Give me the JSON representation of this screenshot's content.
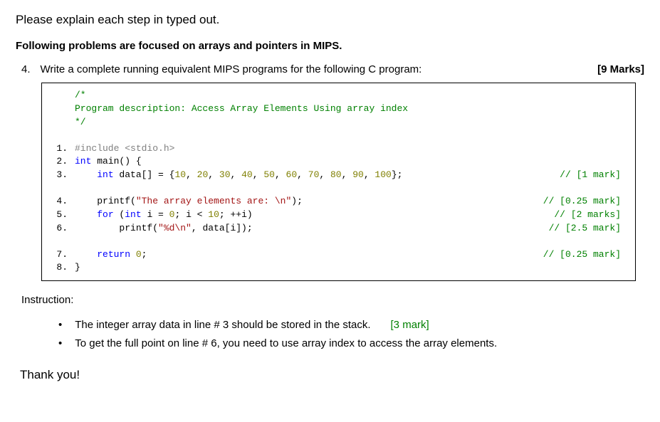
{
  "intro": "Please explain each step in typed out.",
  "heading": "Following problems are focused on arrays and pointers in MIPS.",
  "question": {
    "number": "4.",
    "text": "Write a complete running equivalent MIPS programs for the following C program:",
    "marks": "[9 Marks]"
  },
  "code": {
    "comment_open": "/*",
    "comment_body": "Program description: Access Array Elements Using array index",
    "comment_close": "*/",
    "lines": [
      {
        "n": "1.",
        "indent": "",
        "tokens": [
          {
            "t": "#include ",
            "c": "pp"
          },
          {
            "t": "<stdio.h>",
            "c": "inc-str"
          }
        ],
        "mark": ""
      },
      {
        "n": "2.",
        "indent": "",
        "tokens": [
          {
            "t": "int",
            "c": "type"
          },
          {
            "t": " main() {",
            "c": ""
          }
        ],
        "mark": ""
      },
      {
        "n": "3.",
        "indent": "    ",
        "tokens": [
          {
            "t": "int",
            "c": "type"
          },
          {
            "t": " data[] = {",
            "c": ""
          },
          {
            "t": "10",
            "c": "num"
          },
          {
            "t": ", ",
            "c": ""
          },
          {
            "t": "20",
            "c": "num"
          },
          {
            "t": ", ",
            "c": ""
          },
          {
            "t": "30",
            "c": "num"
          },
          {
            "t": ", ",
            "c": ""
          },
          {
            "t": "40",
            "c": "num"
          },
          {
            "t": ", ",
            "c": ""
          },
          {
            "t": "50",
            "c": "num"
          },
          {
            "t": ", ",
            "c": ""
          },
          {
            "t": "60",
            "c": "num"
          },
          {
            "t": ", ",
            "c": ""
          },
          {
            "t": "70",
            "c": "num"
          },
          {
            "t": ", ",
            "c": ""
          },
          {
            "t": "80",
            "c": "num"
          },
          {
            "t": ", ",
            "c": ""
          },
          {
            "t": "90",
            "c": "num"
          },
          {
            "t": ", ",
            "c": ""
          },
          {
            "t": "100",
            "c": "num"
          },
          {
            "t": "};",
            "c": ""
          }
        ],
        "mark": "// [1 mark]"
      },
      {
        "blank": true
      },
      {
        "n": "4.",
        "indent": "    ",
        "tokens": [
          {
            "t": "printf(",
            "c": ""
          },
          {
            "t": "\"The array elements are: \\n\"",
            "c": "str"
          },
          {
            "t": ");",
            "c": ""
          }
        ],
        "mark": "// [0.25 mark]"
      },
      {
        "n": "5.",
        "indent": "    ",
        "tokens": [
          {
            "t": "for",
            "c": "kw"
          },
          {
            "t": " (",
            "c": ""
          },
          {
            "t": "int",
            "c": "type"
          },
          {
            "t": " i = ",
            "c": ""
          },
          {
            "t": "0",
            "c": "num"
          },
          {
            "t": "; i < ",
            "c": ""
          },
          {
            "t": "10",
            "c": "num"
          },
          {
            "t": "; ++i)",
            "c": ""
          }
        ],
        "mark": "// [2 marks]"
      },
      {
        "n": "6.",
        "indent": "        ",
        "tokens": [
          {
            "t": "printf(",
            "c": ""
          },
          {
            "t": "\"%d\\n\"",
            "c": "str"
          },
          {
            "t": ", data[i]);",
            "c": ""
          }
        ],
        "mark": "// [2.5 mark]"
      },
      {
        "blank": true
      },
      {
        "n": "7.",
        "indent": "    ",
        "tokens": [
          {
            "t": "return",
            "c": "kw"
          },
          {
            "t": " ",
            "c": ""
          },
          {
            "t": "0",
            "c": "num"
          },
          {
            "t": ";",
            "c": ""
          }
        ],
        "mark": "// [0.25 mark]"
      },
      {
        "n": "8.",
        "indent": "",
        "tokens": [
          {
            "t": "}",
            "c": ""
          }
        ],
        "mark": ""
      }
    ]
  },
  "instruction_label": "Instruction:",
  "bullets": [
    {
      "text": "The integer array data in line # 3 should be stored in the stack.",
      "mark": "[3 mark]"
    },
    {
      "text": "To get the full point on line # 6, you need to use array index to access the array elements.",
      "mark": ""
    }
  ],
  "thanks": "Thank you!"
}
